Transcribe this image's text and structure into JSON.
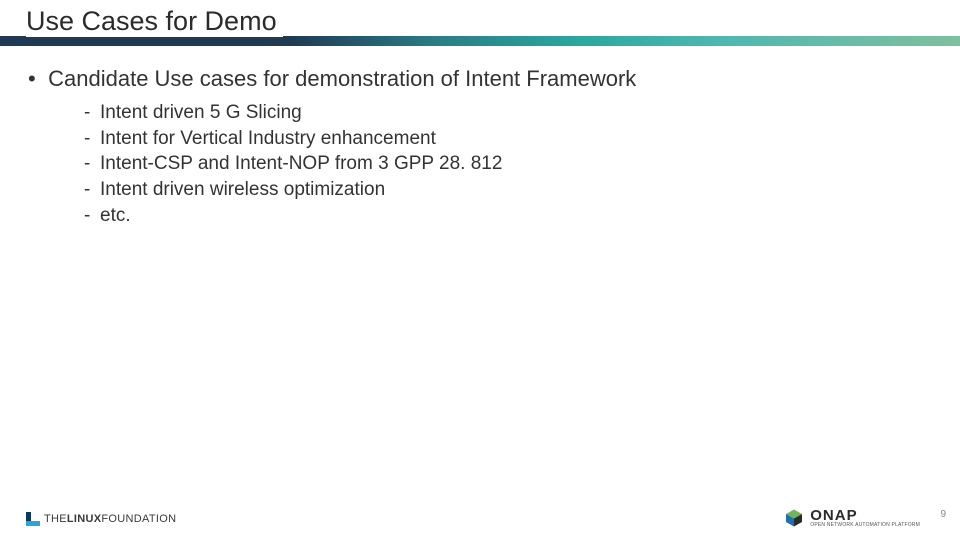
{
  "slide": {
    "title": "Use Cases for Demo",
    "lead_bullet": "Candidate Use cases for demonstration of Intent Framework",
    "sub_bullets": [
      "Intent driven 5 G Slicing",
      "Intent for Vertical Industry enhancement",
      "Intent-CSP and Intent-NOP from 3 GPP 28. 812",
      "Intent driven wireless optimization",
      "etc."
    ]
  },
  "footer": {
    "linux_foundation_prefix": "THE",
    "linux_foundation_main": "LINUX",
    "linux_foundation_suffix": "FOUNDATION",
    "onap_name": "ONAP",
    "onap_tagline": "OPEN NETWORK AUTOMATION PLATFORM",
    "page_number": "9"
  },
  "colors": {
    "stripe_dark": "#1f3a52",
    "stripe_teal": "#2aa79e",
    "text": "#333333"
  }
}
